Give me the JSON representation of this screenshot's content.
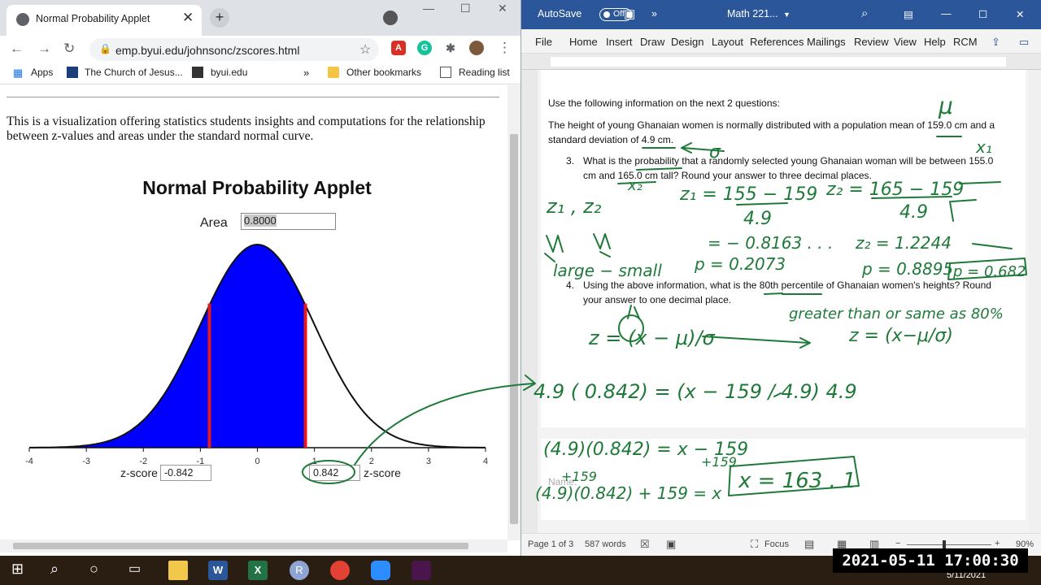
{
  "browser": {
    "tab_title": "Normal Probability Applet",
    "url": "emp.byui.edu/johnsonc/zscores.html",
    "bookmarks": [
      "Apps",
      "The Church of Jesus...",
      "byui.edu",
      "Other bookmarks",
      "Reading list"
    ],
    "bookmark_more": "»"
  },
  "applet": {
    "intro": "This is a visualization offering statistics students insights and computations for the relationship between z-values and areas under the standard normal curve.",
    "title": "Normal Probability Applet",
    "area_label": "Area",
    "area_value": "0.8000",
    "z_label_left": "z-score",
    "z_value_left": "-0.842",
    "z_value_right": "0.842",
    "z_label_right": "z-score",
    "axis_ticks": [
      "-4",
      "-3",
      "-2",
      "-1",
      "0",
      "1",
      "2",
      "3",
      "4"
    ],
    "shade_color": "#0000ff",
    "cutoff_color": "#e31b1b"
  },
  "chart_data": {
    "type": "area",
    "title": "Normal Probability Applet",
    "xlabel": "z-score",
    "ylabel": "",
    "xlim": [
      -4,
      4
    ],
    "shaded_interval": [
      -0.842,
      0.842
    ],
    "area": 0.8,
    "series": [
      {
        "values": "standard normal density"
      }
    ]
  },
  "word": {
    "autosave": "AutoSave",
    "autosave_state": "Off",
    "doc_title": "Math 221...",
    "tabs": [
      "File",
      "Home",
      "Insert",
      "Draw",
      "Design",
      "Layout",
      "References",
      "Mailings",
      "Review",
      "View",
      "Help",
      "RCM"
    ],
    "p1": "Use the following information on the next 2 questions:",
    "p2a": "The height of young Ghanaian women is normally distributed with a population mean of 159.0 cm and a",
    "p2b": "standard deviation of 4.9 cm.",
    "q3_num": "3.",
    "q3a": "What is the probability that a randomly selected young Ghanaian woman will be between 155.0",
    "q3b": "cm and 165.0 cm tall? Round your answer to three decimal places.",
    "q4_num": "4.",
    "q4a": "Using the above information, what is the 80th percentile of Ghanaian women's heights? Round",
    "q4b": "your answer to one decimal place.",
    "name_label": "Name:",
    "status_page": "Page 1 of 3",
    "status_words": "587 words",
    "status_focus": "Focus",
    "zoom": "90%"
  },
  "ink": {
    "mu": "μ",
    "sigma": "σ",
    "x1": "x₁",
    "x2": "x₂",
    "z1z2": "z₁ , z₂",
    "z1_eq": "z₁ = 155 − 159",
    "z1_den": "4.9",
    "z2_eq": "z₂ = 165 − 159",
    "z2_den": "4.9",
    "z1_val": "= − 0.8163 . . .",
    "p1_val": "p = 0.2073",
    "z2_val": "z₂ = 1.2244",
    "p2_val": "p = 0.8895",
    "p_box": "p = 0.682",
    "large_small": "large − small",
    "greater": "greater than or same as 80%",
    "z_formula": "z = (x − μ)/σ",
    "z_formula2": "z = (x−μ/σ)",
    "eq1": "4.9 ( 0.842) = (x − 159 / 4.9) 4.9",
    "eq2": "(4.9)(0.842) = x − 159",
    "plus159": "+159",
    "plus159b": "+159",
    "eq3": "(4.9)(0.842) + 159 = x",
    "answer": "x = 163 . 1"
  },
  "taskbar": {
    "clock": "2021-05-11 17:00:30",
    "date": "5/11/2021"
  }
}
